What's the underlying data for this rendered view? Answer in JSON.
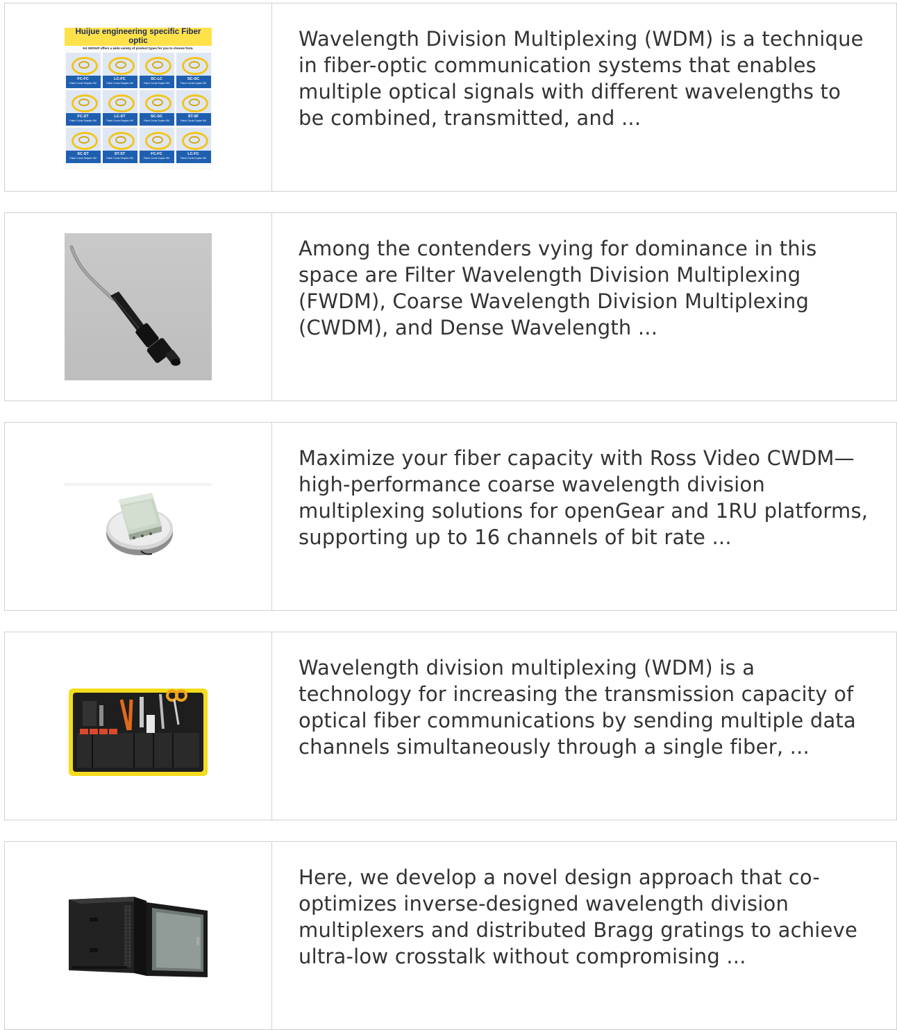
{
  "results": [
    {
      "thumbnail": {
        "title": "Huijue engineering specific Fiber optic",
        "subtitle": "HJ GROUP offers a wide variety of product types for you to choose from.",
        "items": [
          {
            "name": "FC-FC",
            "desc": "Patch Cords Simplex 9M"
          },
          {
            "name": "LC-FC",
            "desc": "Patch Cords Simplex 9M"
          },
          {
            "name": "SC-LC",
            "desc": "Patch Cords Duplex 9M"
          },
          {
            "name": "SC-SC",
            "desc": "Patch Cords Duplex 9M"
          },
          {
            "name": "FC-ST",
            "desc": "Patch Cords Simplex 9M"
          },
          {
            "name": "LC-ST",
            "desc": "Patch Cords Simplex 9M"
          },
          {
            "name": "SC-SC",
            "desc": "Patch Cords Duplex 9M"
          },
          {
            "name": "ST-SF",
            "desc": "Patch Cords Duplex 9M"
          },
          {
            "name": "SC-ST",
            "desc": "Patch Cords Simplex 9M"
          },
          {
            "name": "ST-ST",
            "desc": "Patch Cords Simplex 9M"
          },
          {
            "name": "FC-FC",
            "desc": "Patch Cords Duplex 9M"
          },
          {
            "name": "LC-FC",
            "desc": "Patch Cords Duplex 9M"
          }
        ]
      },
      "snippet": "Wavelength Division Multiplexing (WDM) is a technique in fiber-optic communication systems that enables multiple optical signals with different wavelengths to be combined, transmitted, and ..."
    },
    {
      "thumbnail": {
        "icon": "fiber-connector-image"
      },
      "snippet": "Among the contenders vying for dominance in this space are Filter Wavelength Division Multiplexing (FWDM), Coarse Wavelength Division Multiplexing (CWDM), and Dense Wavelength ..."
    },
    {
      "thumbnail": {
        "icon": "splice-enclosure-image"
      },
      "snippet": "Maximize your fiber capacity with Ross Video CWDM—high-performance coarse wavelength division multiplexing solutions for openGear and 1RU platforms, supporting up to 16 channels of bit rate ..."
    },
    {
      "thumbnail": {
        "icon": "fiber-tool-kit-image"
      },
      "snippet": "Wavelength division multiplexing (WDM) is a technology for increasing the transmission capacity of optical fiber communications by sending multiple data channels simultaneously through a single fiber, ..."
    },
    {
      "thumbnail": {
        "icon": "network-cabinet-image"
      },
      "snippet": "Here, we develop a novel design approach that co-optimizes inverse-designed wavelength division multiplexers and distributed Bragg gratings to achieve ultra-low crosstalk without compromising ..."
    }
  ]
}
